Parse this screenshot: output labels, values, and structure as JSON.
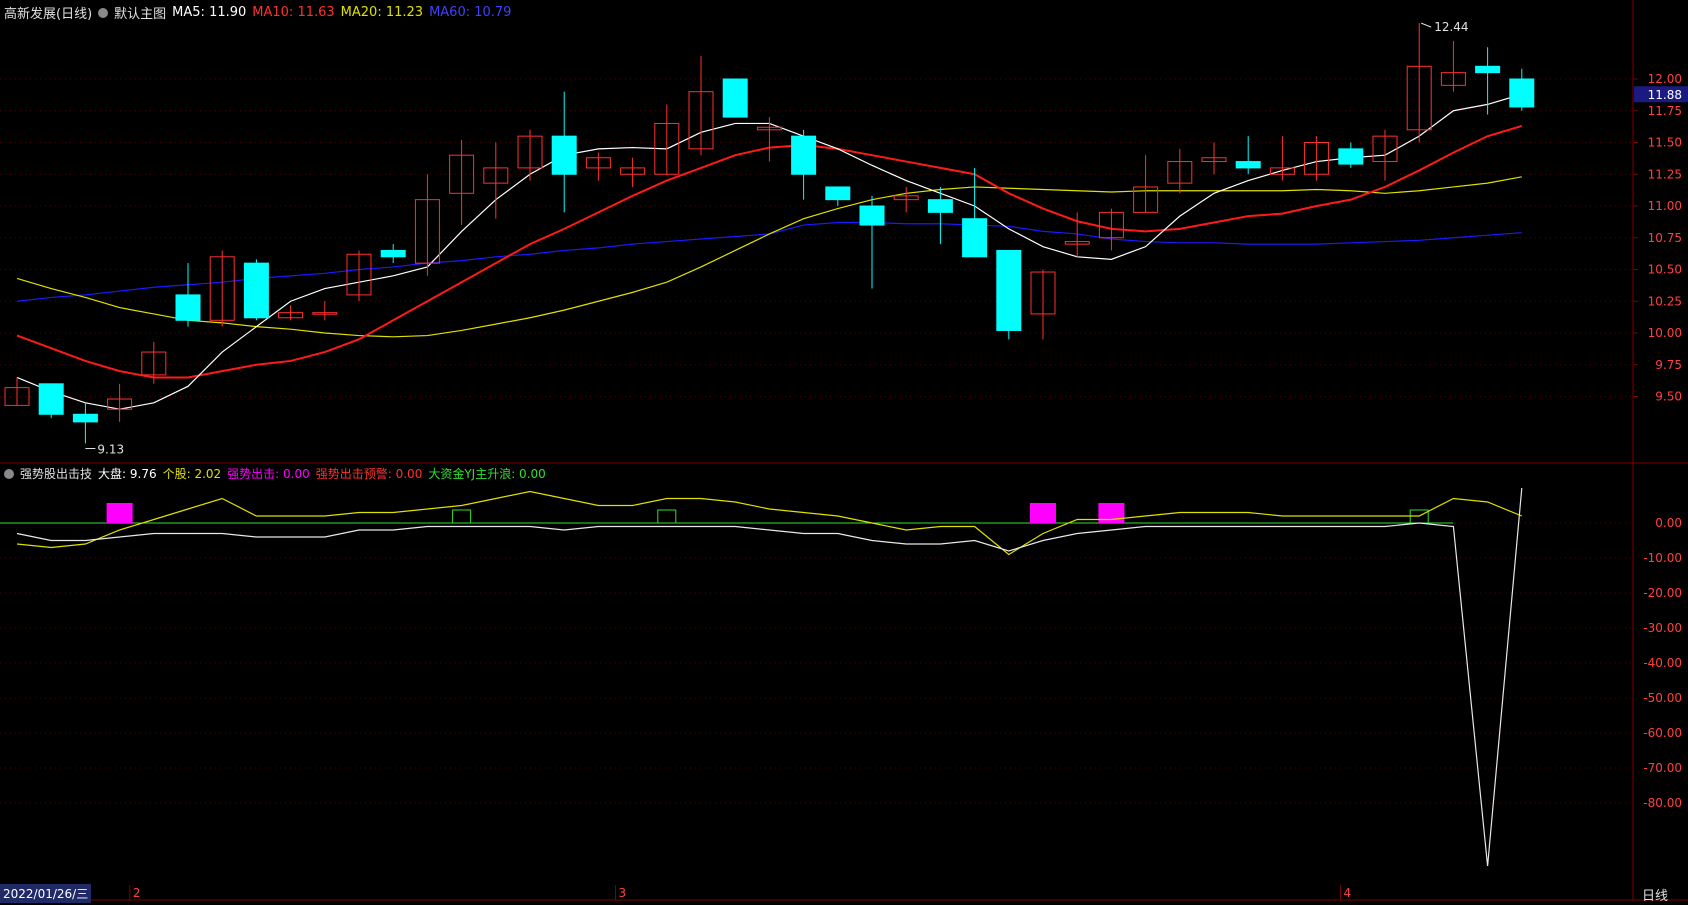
{
  "colors": {
    "up": "#ff3030",
    "down": "#00ffff",
    "ma5": "#ffffff",
    "ma10": "#ff1a1a",
    "ma20": "#e0e000",
    "ma60": "#1a1aff",
    "grid": "#5a0000",
    "axis": "#800000"
  },
  "header": {
    "title": "高新发展(日线)",
    "template": "默认主图",
    "ma5": "MA5: 11.90",
    "ma10": "MA10: 11.63",
    "ma20": "MA20: 11.23",
    "ma60": "MA60: 10.79"
  },
  "indicator_header": {
    "name": "强势股出击技",
    "dapan": "大盘: 9.76",
    "gegu": "个股: 2.02",
    "qiangshi": "强势出击: 0.00",
    "yujing": "强势出击预警: 0.00",
    "dazijin": "大资金YJ主升浪: 0.00"
  },
  "footer": {
    "date": "2022/01/26/三",
    "period": "日线",
    "months": [
      "2",
      "3",
      "4"
    ]
  },
  "price_marks": {
    "high": "12.44",
    "low": "9.13",
    "current": "11.88"
  },
  "chart_data": [
    {
      "type": "candlestick",
      "title": "高新发展(日线)",
      "ylim": [
        9.1,
        12.6
      ],
      "yticks": [
        "9.50",
        "9.75",
        "10.00",
        "10.25",
        "10.50",
        "10.75",
        "11.00",
        "11.25",
        "11.50",
        "11.75",
        "12.00"
      ],
      "ohlc": [
        [
          9.43,
          9.65,
          9.43,
          9.57
        ],
        [
          9.6,
          9.6,
          9.33,
          9.36
        ],
        [
          9.36,
          9.45,
          9.13,
          9.3
        ],
        [
          9.4,
          9.6,
          9.3,
          9.48
        ],
        [
          9.67,
          9.93,
          9.6,
          9.85
        ],
        [
          10.3,
          10.55,
          10.05,
          10.1
        ],
        [
          10.1,
          10.65,
          10.05,
          10.6
        ],
        [
          10.55,
          10.58,
          10.1,
          10.12
        ],
        [
          10.12,
          10.22,
          10.1,
          10.16
        ],
        [
          10.15,
          10.25,
          10.1,
          10.16
        ],
        [
          10.3,
          10.65,
          10.25,
          10.62
        ],
        [
          10.65,
          10.7,
          10.55,
          10.6
        ],
        [
          10.55,
          11.25,
          10.45,
          11.05
        ],
        [
          11.1,
          11.52,
          10.85,
          11.4
        ],
        [
          11.18,
          11.5,
          10.9,
          11.3
        ],
        [
          11.3,
          11.6,
          11.2,
          11.55
        ],
        [
          11.55,
          11.9,
          10.95,
          11.25
        ],
        [
          11.3,
          11.42,
          11.2,
          11.38
        ],
        [
          11.25,
          11.38,
          11.15,
          11.3
        ],
        [
          11.25,
          11.8,
          11.25,
          11.65
        ],
        [
          11.45,
          12.18,
          11.4,
          11.9
        ],
        [
          12.0,
          12.0,
          11.7,
          11.7
        ],
        [
          11.6,
          11.7,
          11.35,
          11.62
        ],
        [
          11.55,
          11.6,
          11.05,
          11.25
        ],
        [
          11.15,
          11.15,
          11.0,
          11.05
        ],
        [
          11.0,
          11.08,
          10.35,
          10.85
        ],
        [
          11.05,
          11.15,
          10.95,
          11.08
        ],
        [
          11.05,
          11.15,
          10.7,
          10.95
        ],
        [
          10.9,
          11.3,
          10.65,
          10.6
        ],
        [
          10.65,
          10.65,
          9.95,
          10.02
        ],
        [
          10.15,
          10.5,
          9.95,
          10.48
        ],
        [
          10.7,
          10.95,
          10.6,
          10.72
        ],
        [
          10.75,
          10.98,
          10.65,
          10.95
        ],
        [
          10.95,
          11.4,
          10.95,
          11.15
        ],
        [
          11.18,
          11.45,
          11.1,
          11.35
        ],
        [
          11.35,
          11.5,
          11.25,
          11.38
        ],
        [
          11.35,
          11.55,
          11.25,
          11.3
        ],
        [
          11.25,
          11.55,
          11.2,
          11.3
        ],
        [
          11.25,
          11.55,
          11.2,
          11.5
        ],
        [
          11.45,
          11.5,
          11.3,
          11.33
        ],
        [
          11.35,
          11.6,
          11.2,
          11.55
        ],
        [
          11.6,
          12.44,
          11.5,
          12.1
        ],
        [
          11.95,
          12.3,
          11.9,
          12.05
        ],
        [
          12.1,
          12.25,
          11.72,
          12.05
        ],
        [
          12.0,
          12.08,
          11.75,
          11.78
        ]
      ],
      "ma5": [
        9.65,
        9.54,
        9.45,
        9.4,
        9.45,
        9.58,
        9.85,
        10.05,
        10.25,
        10.35,
        10.4,
        10.45,
        10.52,
        10.8,
        11.05,
        11.25,
        11.4,
        11.45,
        11.46,
        11.45,
        11.58,
        11.65,
        11.65,
        11.55,
        11.45,
        11.32,
        11.2,
        11.1,
        11.0,
        10.82,
        10.68,
        10.6,
        10.58,
        10.68,
        10.92,
        11.1,
        11.2,
        11.28,
        11.35,
        11.38,
        11.4,
        11.55,
        11.75,
        11.8,
        11.88
      ],
      "ma10": [
        9.98,
        9.88,
        9.78,
        9.7,
        9.65,
        9.65,
        9.7,
        9.75,
        9.78,
        9.85,
        9.95,
        10.1,
        10.25,
        10.4,
        10.55,
        10.7,
        10.82,
        10.95,
        11.08,
        11.2,
        11.3,
        11.4,
        11.46,
        11.48,
        11.45,
        11.4,
        11.35,
        11.3,
        11.25,
        11.1,
        10.98,
        10.88,
        10.82,
        10.8,
        10.82,
        10.87,
        10.92,
        10.94,
        11.0,
        11.05,
        11.15,
        11.28,
        11.42,
        11.55,
        11.63
      ],
      "ma20": [
        10.43,
        10.35,
        10.28,
        10.2,
        10.15,
        10.1,
        10.08,
        10.05,
        10.03,
        10.0,
        9.98,
        9.97,
        9.98,
        10.02,
        10.07,
        10.12,
        10.18,
        10.25,
        10.32,
        10.4,
        10.52,
        10.65,
        10.78,
        10.9,
        10.98,
        11.05,
        11.1,
        11.13,
        11.15,
        11.14,
        11.13,
        11.12,
        11.11,
        11.12,
        11.12,
        11.12,
        11.12,
        11.12,
        11.13,
        11.12,
        11.1,
        11.12,
        11.15,
        11.18,
        11.23
      ],
      "ma60": [
        10.25,
        10.28,
        10.3,
        10.33,
        10.36,
        10.38,
        10.4,
        10.43,
        10.45,
        10.47,
        10.5,
        10.52,
        10.55,
        10.57,
        10.6,
        10.62,
        10.65,
        10.67,
        10.7,
        10.72,
        10.74,
        10.76,
        10.78,
        10.85,
        10.87,
        10.87,
        10.86,
        10.86,
        10.85,
        10.84,
        10.8,
        10.78,
        10.74,
        10.72,
        10.71,
        10.71,
        10.7,
        10.7,
        10.7,
        10.71,
        10.72,
        10.73,
        10.75,
        10.77,
        10.79
      ]
    },
    {
      "type": "line",
      "title": "强势股出击技",
      "ylim": [
        -100,
        12
      ],
      "yticks": [
        "0.00",
        "-10.00",
        "-20.00",
        "-30.00",
        "-40.00",
        "-50.00",
        "-60.00",
        "-70.00",
        "-80.00"
      ],
      "series": [
        {
          "name": "大盘",
          "values": [
            -3,
            -5,
            -5,
            -4,
            -3,
            -3,
            -3,
            -4,
            -4,
            -4,
            -2,
            -2,
            -1,
            -1,
            -1,
            -1,
            -2,
            -1,
            -1,
            -1,
            -1,
            -1,
            -2,
            -3,
            -3,
            -5,
            -6,
            -6,
            -5,
            -8,
            -5,
            -3,
            -2,
            -1,
            -1,
            -1,
            -1,
            -1,
            -1,
            -1,
            -1,
            0,
            -1,
            -98,
            10
          ]
        },
        {
          "name": "个股",
          "values": [
            -6,
            -7,
            -6,
            -2,
            1,
            4,
            7,
            2,
            2,
            2,
            3,
            3,
            4,
            5,
            7,
            9,
            7,
            5,
            5,
            7,
            7,
            6,
            4,
            3,
            2,
            0,
            -2,
            -1,
            -1,
            -9,
            -3,
            1,
            1,
            2,
            3,
            3,
            3,
            2,
            2,
            2,
            2,
            2,
            7,
            6,
            2
          ]
        }
      ],
      "strong_bars": [
        3,
        30,
        32
      ],
      "warning_bars": [
        13,
        19,
        41
      ]
    }
  ]
}
